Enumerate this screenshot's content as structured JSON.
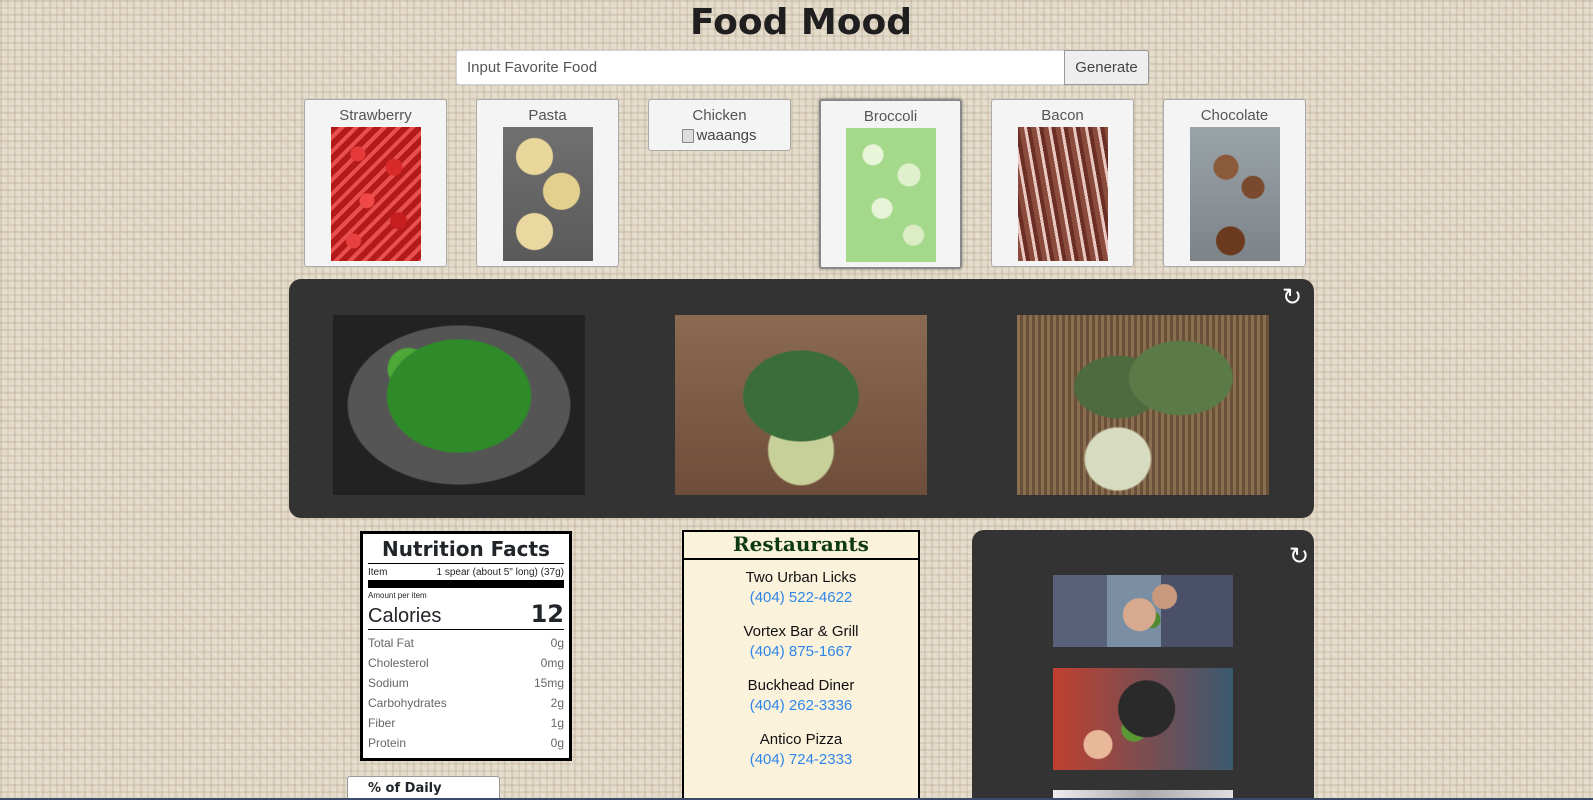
{
  "header": {
    "title": "Food Mood",
    "search_placeholder": "Input Favorite Food",
    "generate_label": "Generate"
  },
  "food_cards": [
    {
      "label": "Strawberry"
    },
    {
      "label": "Pasta"
    },
    {
      "label": "Chicken",
      "broken_image_alt": "waaangs"
    },
    {
      "label": "Broccoli",
      "selected": true
    },
    {
      "label": "Bacon"
    },
    {
      "label": "Chocolate"
    }
  ],
  "icons": {
    "gallery_refresh": "refresh-icon",
    "gif_refresh": "refresh-icon"
  },
  "nutrition": {
    "title": "Nutrition Facts",
    "item_label": "Item",
    "item_value": "1 spear (about 5\" long) (37g)",
    "amount_label": "Amount per item",
    "calories_label": "Calories",
    "calories_value": "12",
    "rows": [
      {
        "label": "Total Fat",
        "value": "0g"
      },
      {
        "label": "Cholesterol",
        "value": "0mg"
      },
      {
        "label": "Sodium",
        "value": "15mg"
      },
      {
        "label": "Carbohydrates",
        "value": "2g"
      },
      {
        "label": "Fiber",
        "value": "1g"
      },
      {
        "label": "Protein",
        "value": "0g"
      }
    ],
    "daily_tab": "% of Daily"
  },
  "restaurants": {
    "title": "Restaurants",
    "items": [
      {
        "name": "Two Urban Licks",
        "phone": "(404) 522-4622"
      },
      {
        "name": "Vortex Bar & Grill",
        "phone": "(404) 875-1667"
      },
      {
        "name": "Buckhead Diner",
        "phone": "(404) 262-3336"
      },
      {
        "name": "Antico Pizza",
        "phone": "(404) 724-2333"
      }
    ]
  },
  "colors": {
    "panel_dark": "#333333",
    "phone_link": "#2f86e8",
    "restaurants_bg": "#fbf2dc",
    "restaurants_title": "#0e3a12"
  }
}
